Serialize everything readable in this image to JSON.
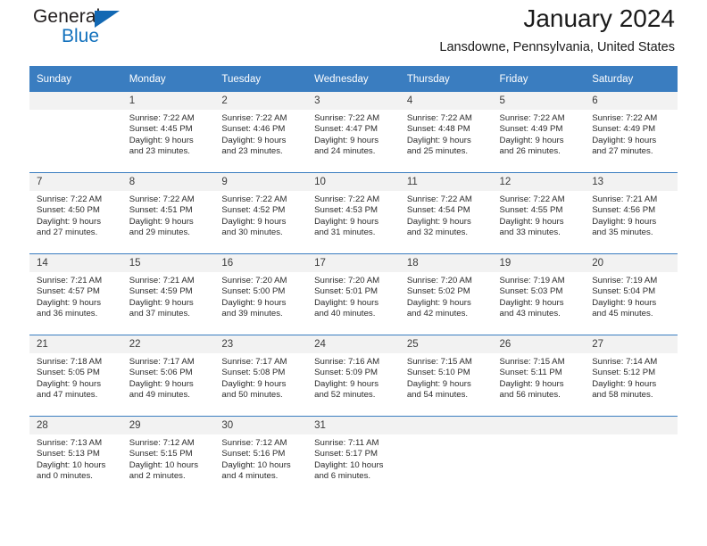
{
  "brand": {
    "line1": "General",
    "line2": "Blue",
    "logo_icon": "triangle-flag-icon",
    "colors": {
      "text": "#231f20",
      "accent": "#1271bd"
    }
  },
  "header": {
    "title": "January 2024",
    "location": "Lansdowne, Pennsylvania, United States"
  },
  "calendar": {
    "header_bg": "#3a7dc0",
    "daynum_bg": "#f2f2f2",
    "weekdays": [
      "Sunday",
      "Monday",
      "Tuesday",
      "Wednesday",
      "Thursday",
      "Friday",
      "Saturday"
    ],
    "weeks": [
      [
        {
          "day": "",
          "lines": []
        },
        {
          "day": "1",
          "lines": [
            "Sunrise: 7:22 AM",
            "Sunset: 4:45 PM",
            "Daylight: 9 hours",
            "and 23 minutes."
          ]
        },
        {
          "day": "2",
          "lines": [
            "Sunrise: 7:22 AM",
            "Sunset: 4:46 PM",
            "Daylight: 9 hours",
            "and 23 minutes."
          ]
        },
        {
          "day": "3",
          "lines": [
            "Sunrise: 7:22 AM",
            "Sunset: 4:47 PM",
            "Daylight: 9 hours",
            "and 24 minutes."
          ]
        },
        {
          "day": "4",
          "lines": [
            "Sunrise: 7:22 AM",
            "Sunset: 4:48 PM",
            "Daylight: 9 hours",
            "and 25 minutes."
          ]
        },
        {
          "day": "5",
          "lines": [
            "Sunrise: 7:22 AM",
            "Sunset: 4:49 PM",
            "Daylight: 9 hours",
            "and 26 minutes."
          ]
        },
        {
          "day": "6",
          "lines": [
            "Sunrise: 7:22 AM",
            "Sunset: 4:49 PM",
            "Daylight: 9 hours",
            "and 27 minutes."
          ]
        }
      ],
      [
        {
          "day": "7",
          "lines": [
            "Sunrise: 7:22 AM",
            "Sunset: 4:50 PM",
            "Daylight: 9 hours",
            "and 27 minutes."
          ]
        },
        {
          "day": "8",
          "lines": [
            "Sunrise: 7:22 AM",
            "Sunset: 4:51 PM",
            "Daylight: 9 hours",
            "and 29 minutes."
          ]
        },
        {
          "day": "9",
          "lines": [
            "Sunrise: 7:22 AM",
            "Sunset: 4:52 PM",
            "Daylight: 9 hours",
            "and 30 minutes."
          ]
        },
        {
          "day": "10",
          "lines": [
            "Sunrise: 7:22 AM",
            "Sunset: 4:53 PM",
            "Daylight: 9 hours",
            "and 31 minutes."
          ]
        },
        {
          "day": "11",
          "lines": [
            "Sunrise: 7:22 AM",
            "Sunset: 4:54 PM",
            "Daylight: 9 hours",
            "and 32 minutes."
          ]
        },
        {
          "day": "12",
          "lines": [
            "Sunrise: 7:22 AM",
            "Sunset: 4:55 PM",
            "Daylight: 9 hours",
            "and 33 minutes."
          ]
        },
        {
          "day": "13",
          "lines": [
            "Sunrise: 7:21 AM",
            "Sunset: 4:56 PM",
            "Daylight: 9 hours",
            "and 35 minutes."
          ]
        }
      ],
      [
        {
          "day": "14",
          "lines": [
            "Sunrise: 7:21 AM",
            "Sunset: 4:57 PM",
            "Daylight: 9 hours",
            "and 36 minutes."
          ]
        },
        {
          "day": "15",
          "lines": [
            "Sunrise: 7:21 AM",
            "Sunset: 4:59 PM",
            "Daylight: 9 hours",
            "and 37 minutes."
          ]
        },
        {
          "day": "16",
          "lines": [
            "Sunrise: 7:20 AM",
            "Sunset: 5:00 PM",
            "Daylight: 9 hours",
            "and 39 minutes."
          ]
        },
        {
          "day": "17",
          "lines": [
            "Sunrise: 7:20 AM",
            "Sunset: 5:01 PM",
            "Daylight: 9 hours",
            "and 40 minutes."
          ]
        },
        {
          "day": "18",
          "lines": [
            "Sunrise: 7:20 AM",
            "Sunset: 5:02 PM",
            "Daylight: 9 hours",
            "and 42 minutes."
          ]
        },
        {
          "day": "19",
          "lines": [
            "Sunrise: 7:19 AM",
            "Sunset: 5:03 PM",
            "Daylight: 9 hours",
            "and 43 minutes."
          ]
        },
        {
          "day": "20",
          "lines": [
            "Sunrise: 7:19 AM",
            "Sunset: 5:04 PM",
            "Daylight: 9 hours",
            "and 45 minutes."
          ]
        }
      ],
      [
        {
          "day": "21",
          "lines": [
            "Sunrise: 7:18 AM",
            "Sunset: 5:05 PM",
            "Daylight: 9 hours",
            "and 47 minutes."
          ]
        },
        {
          "day": "22",
          "lines": [
            "Sunrise: 7:17 AM",
            "Sunset: 5:06 PM",
            "Daylight: 9 hours",
            "and 49 minutes."
          ]
        },
        {
          "day": "23",
          "lines": [
            "Sunrise: 7:17 AM",
            "Sunset: 5:08 PM",
            "Daylight: 9 hours",
            "and 50 minutes."
          ]
        },
        {
          "day": "24",
          "lines": [
            "Sunrise: 7:16 AM",
            "Sunset: 5:09 PM",
            "Daylight: 9 hours",
            "and 52 minutes."
          ]
        },
        {
          "day": "25",
          "lines": [
            "Sunrise: 7:15 AM",
            "Sunset: 5:10 PM",
            "Daylight: 9 hours",
            "and 54 minutes."
          ]
        },
        {
          "day": "26",
          "lines": [
            "Sunrise: 7:15 AM",
            "Sunset: 5:11 PM",
            "Daylight: 9 hours",
            "and 56 minutes."
          ]
        },
        {
          "day": "27",
          "lines": [
            "Sunrise: 7:14 AM",
            "Sunset: 5:12 PM",
            "Daylight: 9 hours",
            "and 58 minutes."
          ]
        }
      ],
      [
        {
          "day": "28",
          "lines": [
            "Sunrise: 7:13 AM",
            "Sunset: 5:13 PM",
            "Daylight: 10 hours",
            "and 0 minutes."
          ]
        },
        {
          "day": "29",
          "lines": [
            "Sunrise: 7:12 AM",
            "Sunset: 5:15 PM",
            "Daylight: 10 hours",
            "and 2 minutes."
          ]
        },
        {
          "day": "30",
          "lines": [
            "Sunrise: 7:12 AM",
            "Sunset: 5:16 PM",
            "Daylight: 10 hours",
            "and 4 minutes."
          ]
        },
        {
          "day": "31",
          "lines": [
            "Sunrise: 7:11 AM",
            "Sunset: 5:17 PM",
            "Daylight: 10 hours",
            "and 6 minutes."
          ]
        },
        {
          "day": "",
          "lines": []
        },
        {
          "day": "",
          "lines": []
        },
        {
          "day": "",
          "lines": []
        }
      ]
    ]
  }
}
